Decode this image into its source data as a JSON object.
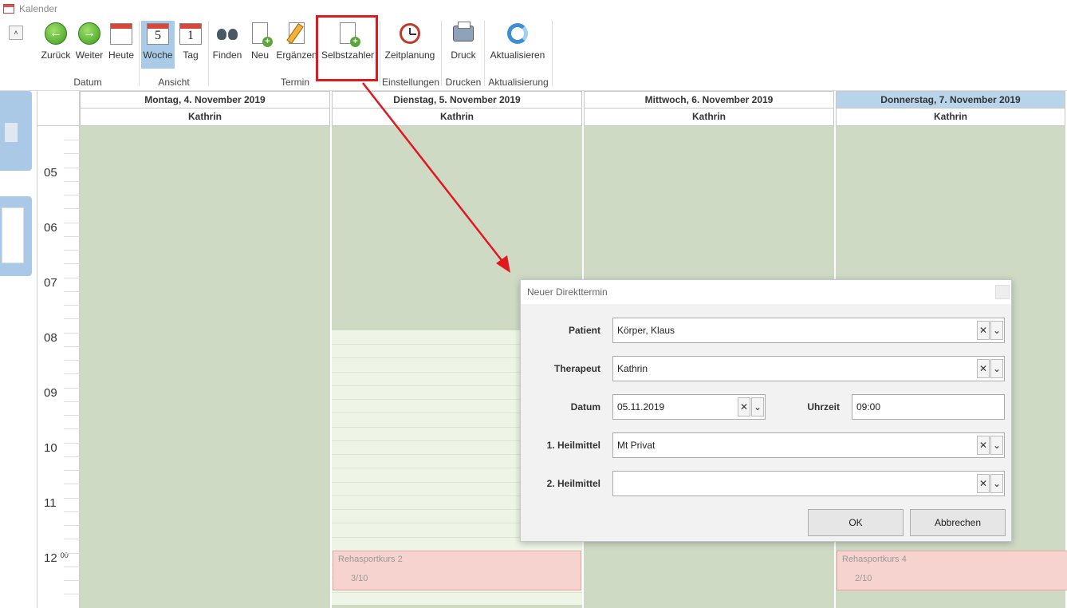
{
  "window": {
    "title": "Kalender"
  },
  "ribbon": {
    "collapse": "˄",
    "buttons": {
      "back": "Zurück",
      "forward": "Weiter",
      "today": "Heute",
      "week": "Woche",
      "day": "Tag",
      "find": "Finden",
      "new": "Neu",
      "complete": "Ergänzen",
      "selfpayer": "Selbstzahler",
      "timeplanning": "Zeitplanung",
      "print": "Druck",
      "refresh": "Aktualisieren"
    },
    "icon_text": {
      "week_number": "5",
      "day_number": "1"
    },
    "groups": {
      "date": "Datum",
      "view": "Ansicht",
      "appointment": "Termin",
      "settings": "Einstellungen",
      "printing": "Drucken",
      "update": "Aktualisierung"
    },
    "highlight_color": "#e0191f"
  },
  "calendar": {
    "hours": [
      "05",
      "06",
      "07",
      "08",
      "09",
      "10",
      "11",
      "12"
    ],
    "minute_label": "00",
    "days": [
      {
        "date": "Montag, 4. November 2019",
        "therapist": "Kathrin",
        "today": false
      },
      {
        "date": "Dienstag, 5. November 2019",
        "therapist": "Kathrin",
        "today": false
      },
      {
        "date": "Mittwoch, 6. November 2019",
        "therapist": "Kathrin",
        "today": false
      },
      {
        "date": "Donnerstag, 7. November 2019",
        "therapist": "Kathrin",
        "today": true
      }
    ],
    "appointments": [
      {
        "title": "Rehasportkurs 2",
        "count": "3/10"
      },
      {
        "title": "Rehasportkurs 4",
        "count": "2/10"
      }
    ],
    "colors": {
      "unavailable": "#cfdac5",
      "available": "#eef5e6",
      "appointment": "#f6d3cf",
      "today_header": "#b8d4ea"
    }
  },
  "dialog": {
    "title": "Neuer Direkttermin",
    "fields": {
      "patient": {
        "label": "Patient",
        "value": "Körper, Klaus"
      },
      "therapist": {
        "label": "Therapeut",
        "value": "Kathrin"
      },
      "date": {
        "label": "Datum",
        "value": "05.11.2019"
      },
      "time": {
        "label": "Uhrzeit",
        "value": "09:00"
      },
      "remedy1": {
        "label": "1. Heilmittel",
        "value": "Mt Privat"
      },
      "remedy2": {
        "label": "2. Heilmittel",
        "value": ""
      }
    },
    "clear_glyph": "✕",
    "dropdown_glyph": "⌄",
    "ok": "OK",
    "cancel": "Abbrechen"
  }
}
